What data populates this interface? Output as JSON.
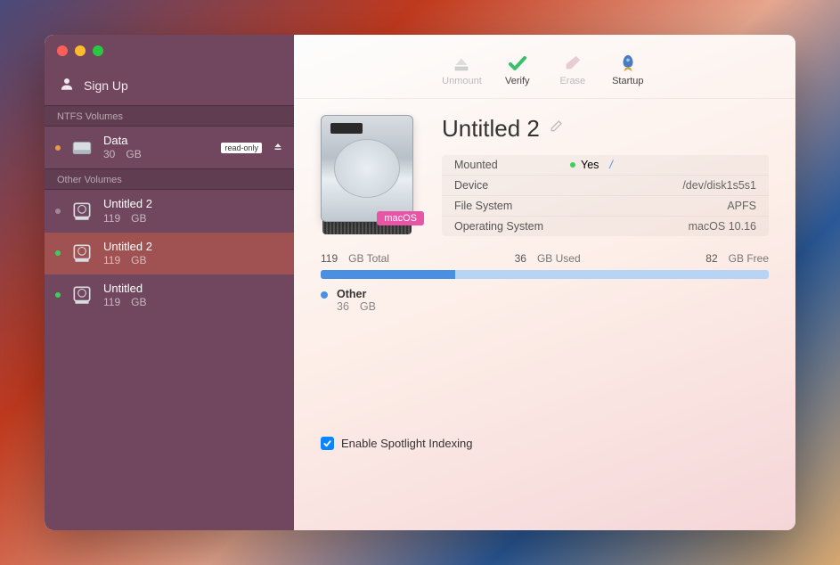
{
  "sidebar": {
    "signup_label": "Sign Up",
    "sections": [
      {
        "header": "NTFS Volumes",
        "items": [
          {
            "name": "Data",
            "size_num": "30",
            "size_unit": "GB",
            "status": "orange",
            "icon": "drive-external",
            "readonly": true,
            "readonly_label": "read-only",
            "ejectable": true
          }
        ]
      },
      {
        "header": "Other Volumes",
        "items": [
          {
            "name": "Untitled 2",
            "size_num": "119",
            "size_unit": "GB",
            "status": "grey",
            "icon": "drive-internal"
          },
          {
            "name": "Untitled 2",
            "size_num": "119",
            "size_unit": "GB",
            "status": "green",
            "icon": "drive-internal",
            "selected": true
          },
          {
            "name": "Untitled",
            "size_num": "119",
            "size_unit": "GB",
            "status": "green",
            "icon": "drive-internal"
          }
        ]
      }
    ]
  },
  "toolbar": {
    "unmount": "Unmount",
    "verify": "Verify",
    "erase": "Erase",
    "startup": "Startup"
  },
  "detail": {
    "title": "Untitled 2",
    "os_badge": "macOS",
    "props": {
      "mounted_label": "Mounted",
      "mounted_value": "Yes",
      "mounted_path": "/",
      "device_label": "Device",
      "device_value": "/dev/disk1s5s1",
      "fs_label": "File System",
      "fs_value": "APFS",
      "os_label": "Operating System",
      "os_value": "macOS 10.16"
    },
    "usage": {
      "total_num": "119",
      "total_label": "GB Total",
      "used_num": "36",
      "used_label": "GB Used",
      "free_num": "82",
      "free_label": "GB Free",
      "fill_percent": 30,
      "legend_name": "Other",
      "legend_num": "36",
      "legend_unit": "GB"
    },
    "spotlight_label": "Enable Spotlight Indexing",
    "spotlight_checked": true
  }
}
